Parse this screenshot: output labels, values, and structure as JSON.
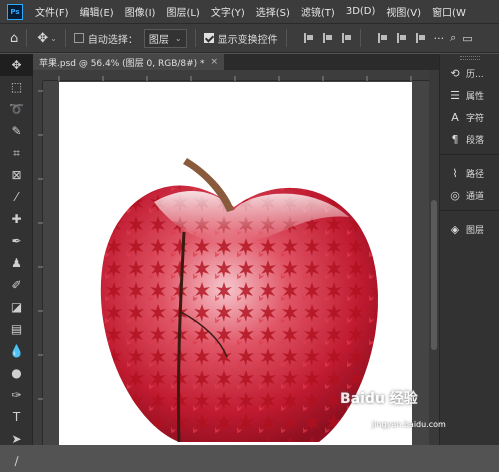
{
  "app": {
    "logo": "Ps"
  },
  "menu": [
    "文件(F)",
    "编辑(E)",
    "图像(I)",
    "图层(L)",
    "文字(Y)",
    "选择(S)",
    "滤镜(T)",
    "3D(D)",
    "视图(V)",
    "窗口(W"
  ],
  "options": {
    "auto_select_label": "自动选择：",
    "auto_select_target": "图层",
    "show_transform_label": "显示变换控件"
  },
  "document_tab": {
    "title": "苹果.psd @ 56.4% (图层 0, RGB/8#) *",
    "close": "×"
  },
  "tools": [
    "move-icon",
    "marquee-icon",
    "lasso-icon",
    "quick-select-icon",
    "crop-icon",
    "frame-icon",
    "eyedropper-icon",
    "healing-icon",
    "brush-icon",
    "stamp-icon",
    "history-brush-icon",
    "eraser-icon",
    "gradient-icon",
    "blur-icon",
    "dodge-icon",
    "pen-icon",
    "type-icon",
    "path-select-icon",
    "rectangle-icon",
    "hand-icon"
  ],
  "panels": {
    "group1": [
      {
        "icon": "history-icon",
        "label": "历..."
      },
      {
        "icon": "properties-icon",
        "label": "属性"
      },
      {
        "icon": "character-icon",
        "label": "字符"
      },
      {
        "icon": "paragraph-icon",
        "label": "段落"
      }
    ],
    "group2": [
      {
        "icon": "paths-icon",
        "label": "路径"
      },
      {
        "icon": "channels-icon",
        "label": "通道"
      }
    ],
    "group3": [
      {
        "icon": "layers-icon",
        "label": "图层"
      }
    ]
  },
  "watermark": {
    "brand": "Baidu 经验",
    "url": "jingyan.baidu.com"
  },
  "colors": {
    "leaf_red": "#c8102e",
    "apple_red": "#d21f35",
    "stem": "#8a5a3c",
    "accent": "#31a8ff"
  }
}
